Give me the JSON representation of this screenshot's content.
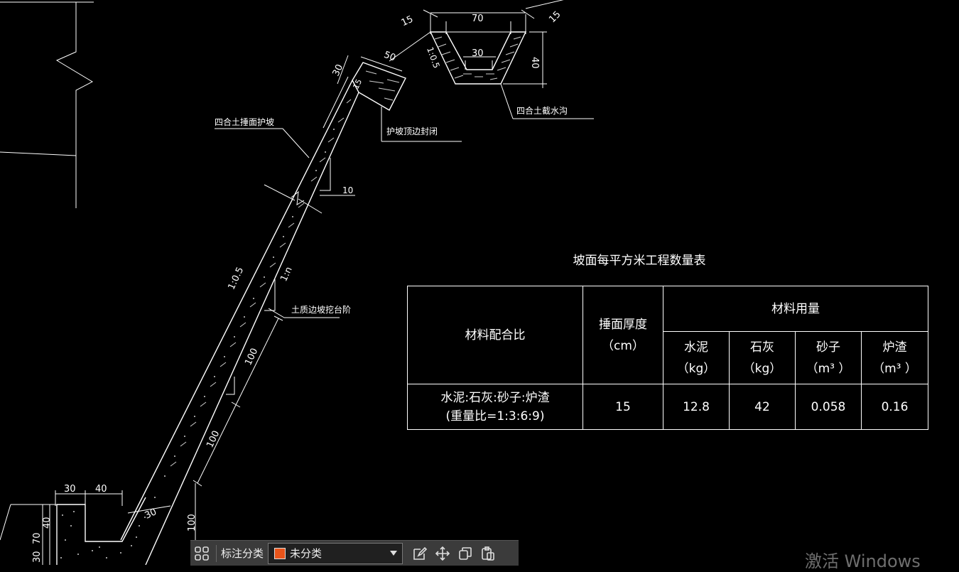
{
  "drawing": {
    "ditch": {
      "dim_top_width": "70",
      "dim_left_wall": "15",
      "dim_right_wall": "15",
      "dim_bottom_width": "30",
      "dim_depth": "40",
      "slope_label": "1:0.5",
      "label": "四合土截水沟"
    },
    "crest": {
      "dim_width": "50",
      "dim_thickness": "30",
      "dim_small": "15",
      "label": "护坡顶边封闭"
    },
    "slope": {
      "facing_label": "四合土捶面护坡",
      "dim_step": "10",
      "outer_slope": "1:0.5",
      "inner_slope": "1:n",
      "step_label": "土质边坡挖台阶",
      "dim_segment_1": "100",
      "dim_segment_2": "100",
      "dim_toe_thickness": "30",
      "dim_toe_height": "100"
    },
    "toe": {
      "dim_a": "30",
      "dim_b": "40",
      "dim_height_1": "70",
      "dim_height_2": "40",
      "dim_height_3": "30"
    }
  },
  "table": {
    "title": "坡面每平方米工程数量表",
    "header_material_ratio": "材料配合比",
    "header_thickness": "捶面厚度",
    "header_thickness_unit": "（cm）",
    "header_usage": "材料用量",
    "columns": [
      {
        "name": "水泥",
        "unit": "（kg）"
      },
      {
        "name": "石灰",
        "unit": "（kg）"
      },
      {
        "name": "砂子",
        "unit": "（m³ ）"
      },
      {
        "name": "炉渣",
        "unit": "（m³ ）"
      }
    ],
    "row": {
      "ratio_line1": "水泥:石灰:砂子:炉渣",
      "ratio_line2": "(重量比=1:3:6:9)",
      "thickness": "15",
      "values": [
        "12.8",
        "42",
        "0.058",
        "0.16"
      ]
    }
  },
  "toolbar": {
    "label": "标注分类",
    "select_value": "未分类",
    "swatch_color": "#e8541a",
    "icons": [
      "grid-icon",
      "edit-icon",
      "move-icon",
      "copy-icon",
      "paste-icon"
    ]
  },
  "watermark": "激活 Windows"
}
